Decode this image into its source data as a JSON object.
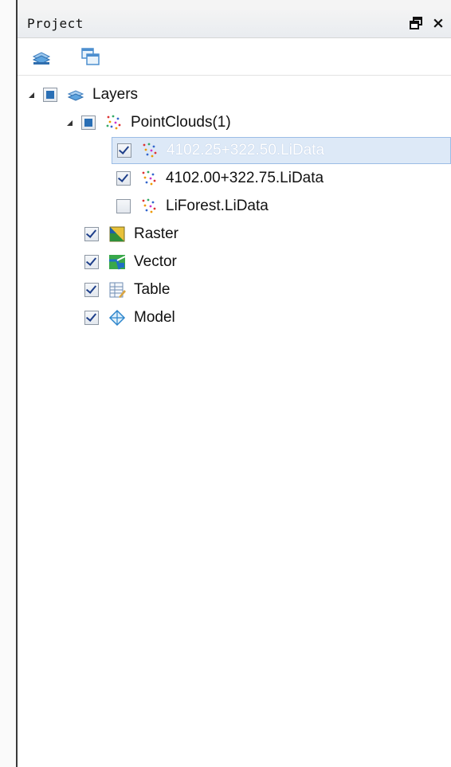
{
  "panel": {
    "title": "Project"
  },
  "toolbar": {
    "buttons": [
      {
        "icon": "layers-icon"
      },
      {
        "icon": "windows-icon"
      }
    ]
  },
  "tree": {
    "root": {
      "label": "Layers",
      "icon": "layers-icon",
      "check": "partial",
      "expanded": true
    },
    "pointclouds": {
      "label": "PointClouds(1)",
      "icon": "pointcloud-icon",
      "check": "partial",
      "expanded": true
    },
    "items": [
      {
        "label": "4102.25+322.50.LiData",
        "icon": "pointcloud-icon",
        "check": "checked",
        "selected": true
      },
      {
        "label": "4102.00+322.75.LiData",
        "icon": "pointcloud-icon",
        "check": "checked",
        "selected": false
      },
      {
        "label": "LiForest.LiData",
        "icon": "pointcloud-icon",
        "check": "unchecked",
        "selected": false
      }
    ],
    "groups": [
      {
        "label": "Raster",
        "icon": "raster-icon",
        "check": "checked"
      },
      {
        "label": "Vector",
        "icon": "vector-icon",
        "check": "checked"
      },
      {
        "label": "Table",
        "icon": "table-icon",
        "check": "checked"
      },
      {
        "label": "Model",
        "icon": "model-icon",
        "check": "checked"
      }
    ]
  },
  "colors": {
    "selection_bg": "#dde9f7",
    "selection_border": "#9cbde6",
    "checkbox_fill": "#2a6fb5"
  }
}
